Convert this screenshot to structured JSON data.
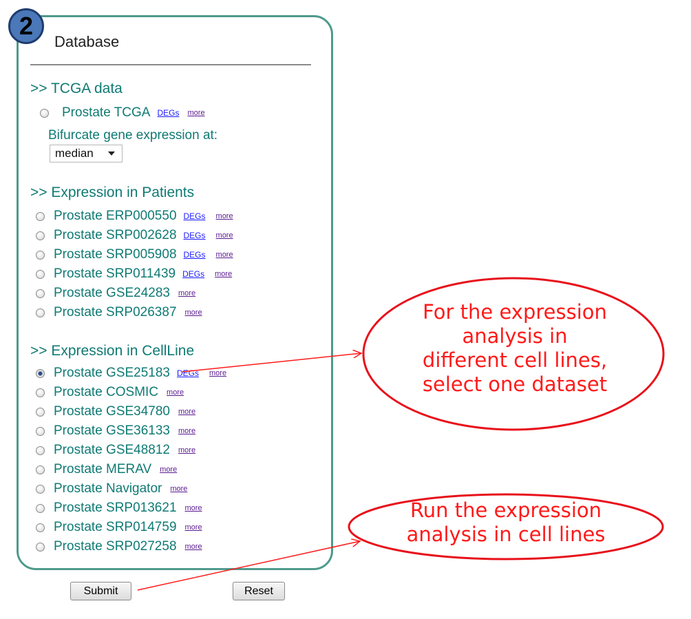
{
  "step": "2",
  "title": "Database",
  "tcga": {
    "header": ">> TCGA data",
    "item": {
      "label": "Prostate TCGA",
      "degs": "DEGs",
      "more": "more"
    },
    "bifurcate_label": "Bifurcate gene expression at:",
    "bifurcate_value": "median"
  },
  "patients": {
    "header": ">> Expression in Patients",
    "items": [
      {
        "label": "Prostate ERP000550",
        "degs": "DEGs",
        "more": "more"
      },
      {
        "label": "Prostate SRP002628",
        "degs": "DEGs",
        "more": "more"
      },
      {
        "label": "Prostate SRP005908",
        "degs": "DEGs",
        "more": "more"
      },
      {
        "label": "Prostate SRP011439",
        "degs": "DEGs",
        "more": "more"
      },
      {
        "label": "Prostate GSE24283",
        "more": "more"
      },
      {
        "label": "Prostate SRP026387",
        "more": "more"
      }
    ]
  },
  "cellline": {
    "header": ">> Expression in CellLine",
    "selected_index": 0,
    "items": [
      {
        "label": "Prostate GSE25183",
        "degs": "DEGs",
        "more": "more"
      },
      {
        "label": "Prostate COSMIC",
        "more": "more"
      },
      {
        "label": "Prostate GSE34780",
        "more": "more"
      },
      {
        "label": "Prostate GSE36133",
        "more": "more"
      },
      {
        "label": "Prostate GSE48812",
        "more": "more"
      },
      {
        "label": "Prostate MERAV",
        "more": "more"
      },
      {
        "label": "Prostate Navigator",
        "more": "more"
      },
      {
        "label": "Prostate SRP013621",
        "more": "more"
      },
      {
        "label": "Prostate SRP014759",
        "more": "more"
      },
      {
        "label": "Prostate SRP027258",
        "more": "more"
      }
    ]
  },
  "buttons": {
    "submit": "Submit",
    "reset": "Reset"
  },
  "callouts": {
    "cellline": [
      "For the expression",
      "analysis in",
      "different cell lines,",
      "select one dataset"
    ],
    "submit": [
      "Run the expression",
      "analysis in cell lines"
    ]
  },
  "colors": {
    "accent": "#0f7a74",
    "panel_border": "#4e9a8c",
    "callout": "#ff1a1a",
    "badge": "#4a78b8"
  }
}
